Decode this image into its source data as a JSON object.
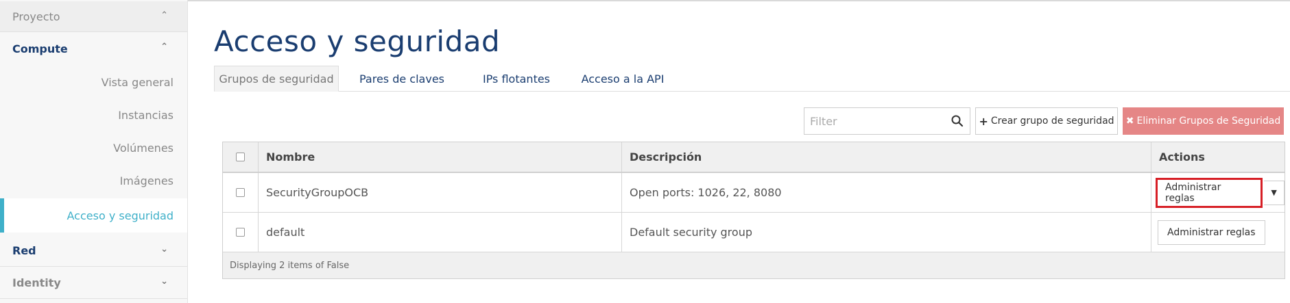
{
  "sidebar": {
    "proyecto": "Proyecto",
    "compute": "Compute",
    "items": [
      {
        "label": "Vista general"
      },
      {
        "label": "Instancias"
      },
      {
        "label": "Volúmenes"
      },
      {
        "label": "Imágenes"
      },
      {
        "label": "Acceso y seguridad"
      }
    ],
    "red": "Red",
    "identity": "Identity"
  },
  "page": {
    "title": "Acceso y seguridad"
  },
  "tabs": [
    {
      "label": "Grupos de seguridad",
      "active": true
    },
    {
      "label": "Pares de claves",
      "active": false
    },
    {
      "label": "IPs flotantes",
      "active": false
    },
    {
      "label": "Acceso a la API",
      "active": false
    }
  ],
  "toolbar": {
    "filter_placeholder": "Filter",
    "create_label": "Crear grupo de seguridad",
    "delete_label": "Eliminar Grupos de Seguridad",
    "delete_color": "#e58686"
  },
  "table": {
    "columns": [
      "Nombre",
      "Descripción",
      "Actions"
    ],
    "rows": [
      {
        "name": "SecurityGroupOCB",
        "description": "Open ports: 1026, 22, 8080",
        "action": "Administrar reglas"
      },
      {
        "name": "default",
        "description": "Default security group",
        "action": "Administrar reglas"
      }
    ],
    "footer": "Displaying 2 items of False"
  },
  "colors": {
    "brand_navy": "#1a3d70",
    "accent_teal": "#3fb0c9",
    "highlight_red": "#d71f26"
  }
}
